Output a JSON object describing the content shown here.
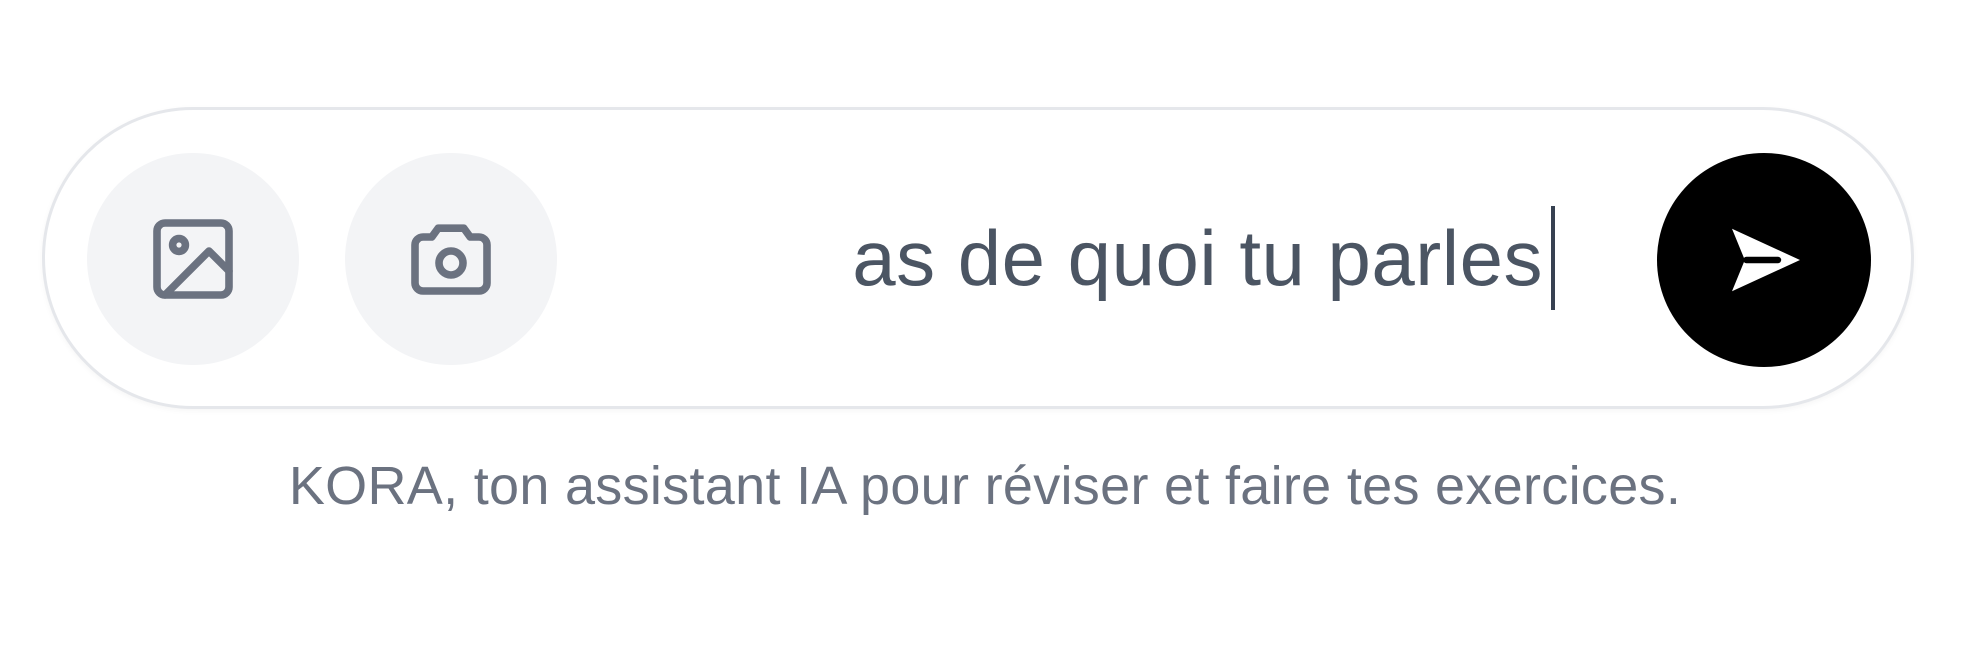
{
  "composer": {
    "image_button": {
      "icon": "image-icon"
    },
    "camera_button": {
      "icon": "camera-icon"
    },
    "input": {
      "value": "as de quoi tu parles"
    },
    "send_button": {
      "icon": "send-icon",
      "color": "#000000"
    }
  },
  "footer": {
    "note": "KORA, ton assistant IA pour réviser et faire tes exercices."
  }
}
